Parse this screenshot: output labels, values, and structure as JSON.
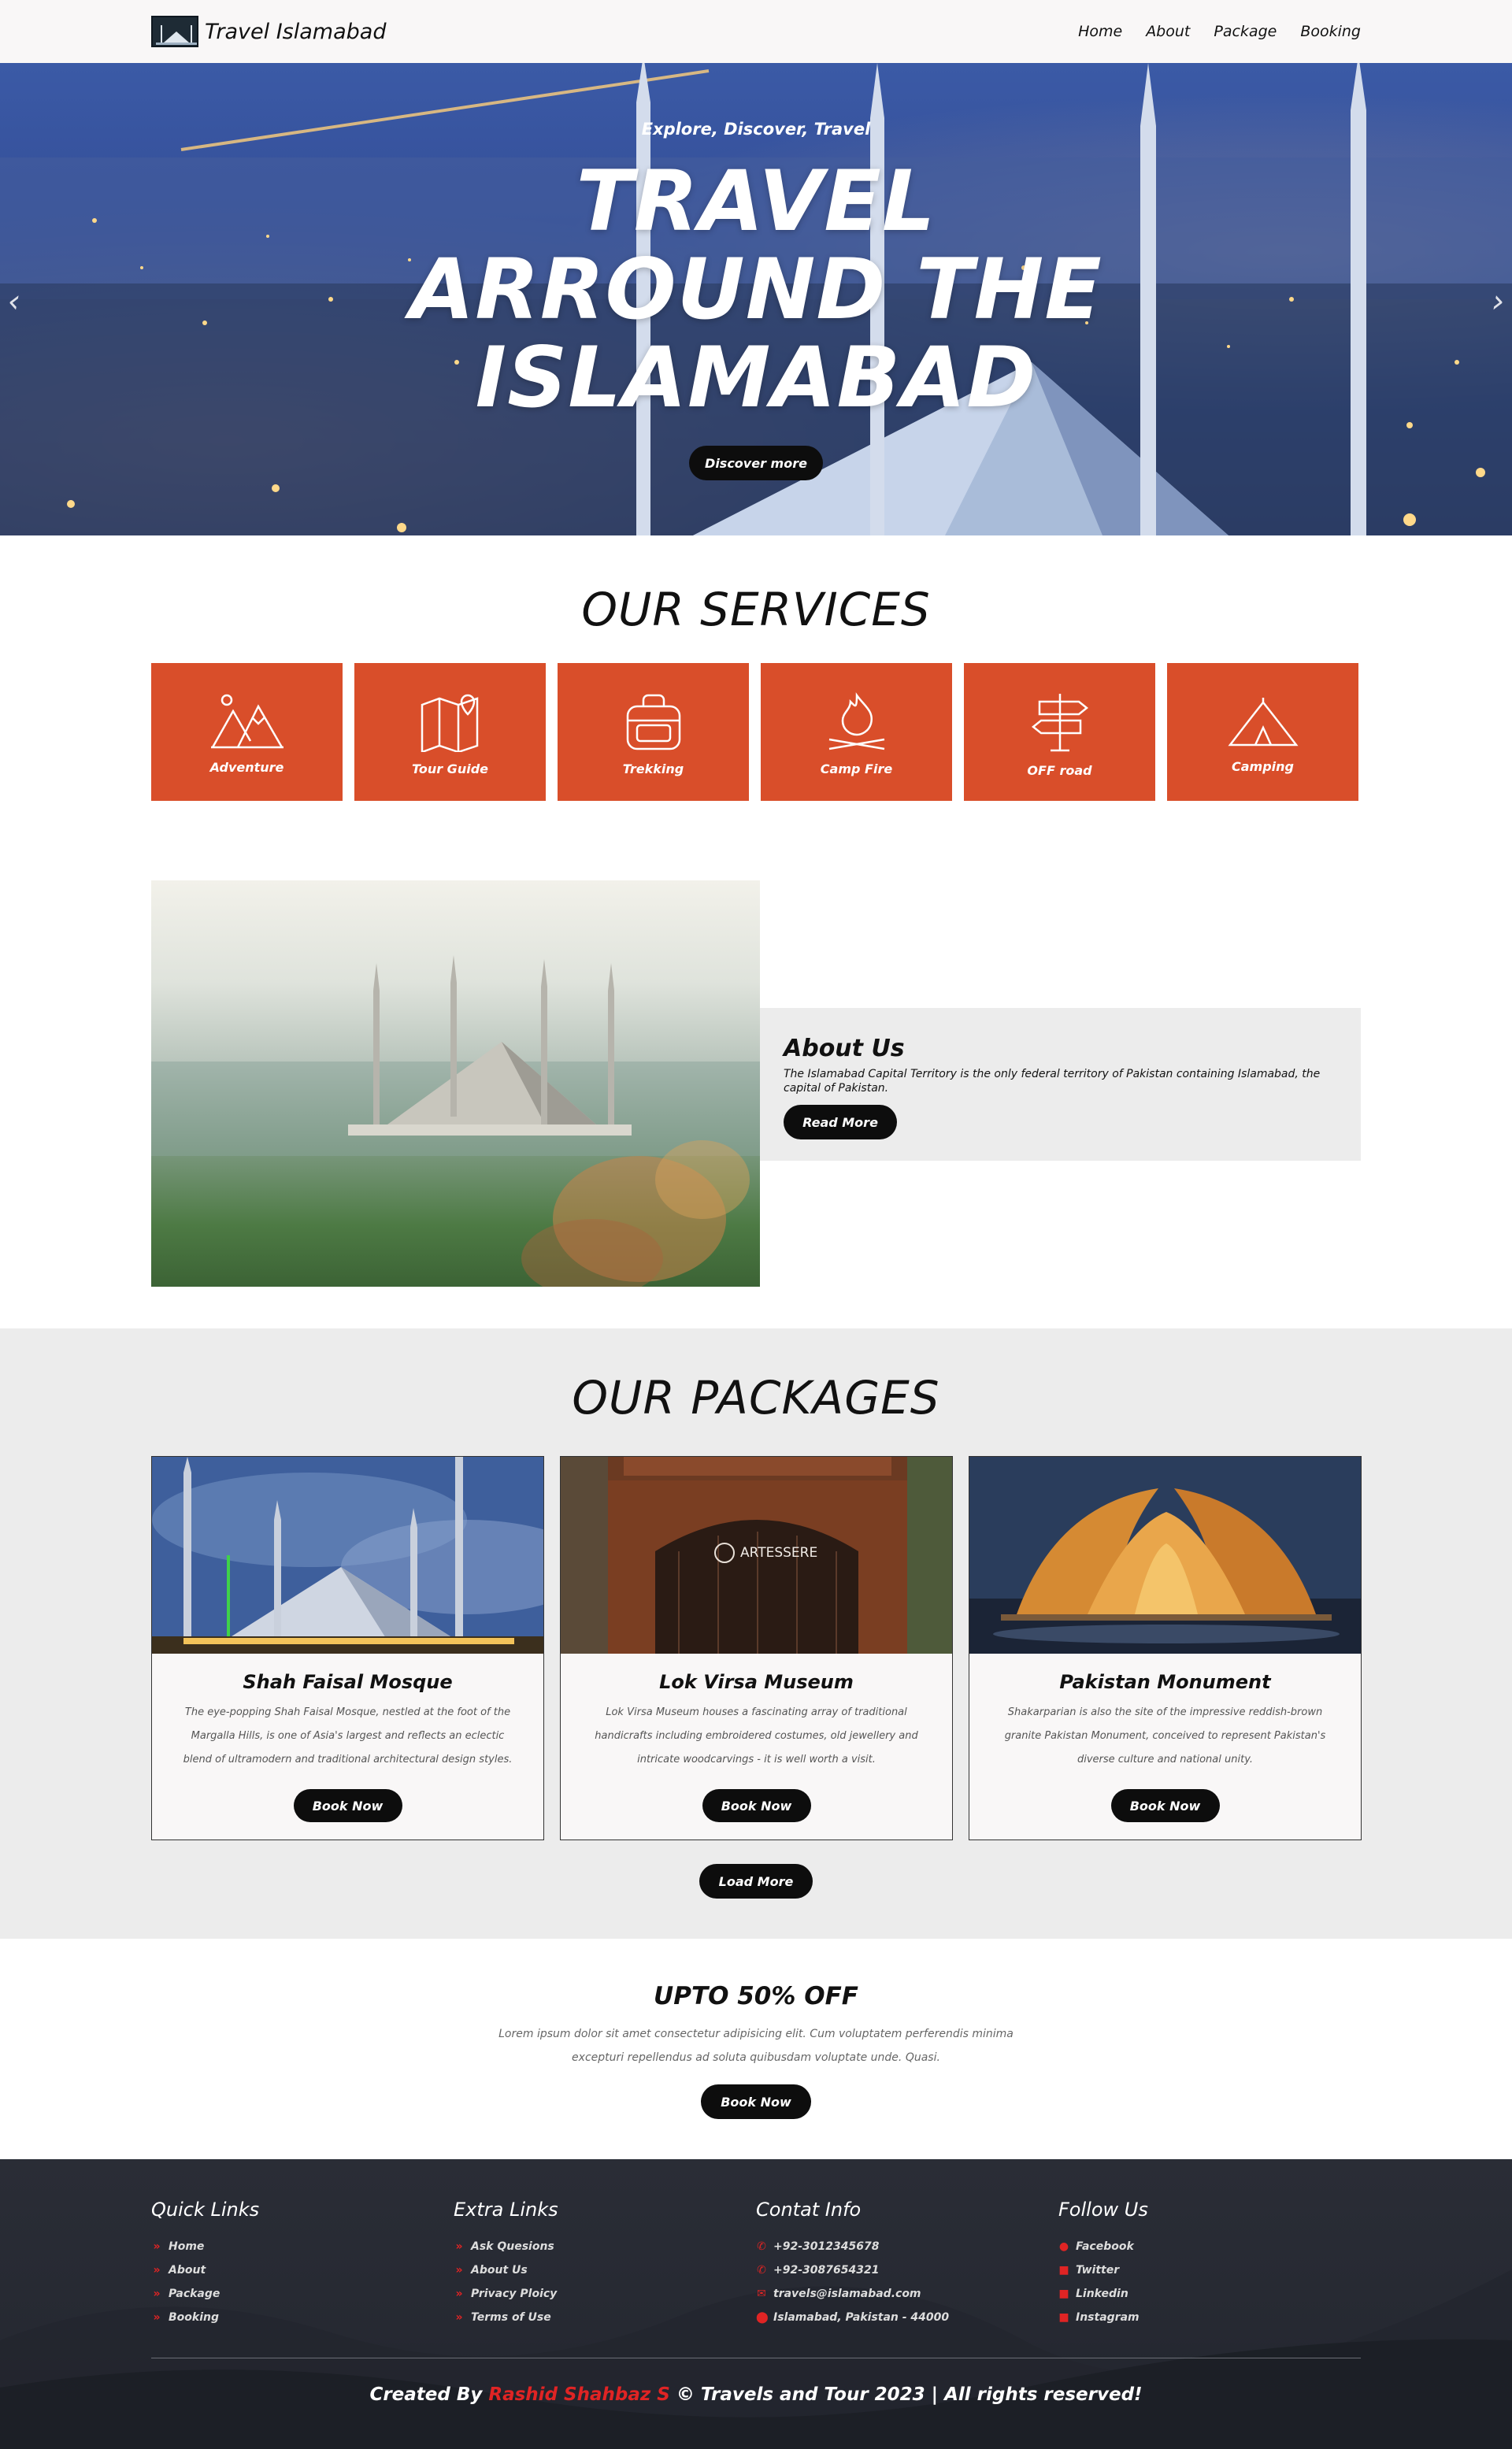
{
  "navbar": {
    "brand": "Travel Islamabad",
    "links": [
      "Home",
      "About",
      "Package",
      "Booking"
    ]
  },
  "hero": {
    "tagline": "Explore, Discover, Travel",
    "title_line1": "TRAVEL",
    "title_line2": "ARROUND THE",
    "title_line3": "ISLAMABAD",
    "button": "Discover more"
  },
  "services": {
    "title": "OUR SERVICES",
    "items": [
      {
        "label": "Adventure",
        "icon": "mountain-icon"
      },
      {
        "label": "Tour Guide",
        "icon": "map-icon"
      },
      {
        "label": "Trekking",
        "icon": "backpack-icon"
      },
      {
        "label": "Camp Fire",
        "icon": "campfire-icon"
      },
      {
        "label": "OFF road",
        "icon": "signpost-icon"
      },
      {
        "label": "Camping",
        "icon": "tent-icon"
      }
    ],
    "card_color": "#d94e2a"
  },
  "about": {
    "title": "About Us",
    "text": "The Islamabad Capital Territory is the only federal territory of Pakistan containing Islamabad, the capital of Pakistan.",
    "button": "Read More"
  },
  "packages": {
    "title": "OUR PACKAGES",
    "items": [
      {
        "name": "Shah Faisal Mosque",
        "desc_lines": [
          "The eye-popping Shah Faisal Mosque, nestled at the foot of the",
          "Margalla Hills, is one of Asia's largest and reflects an eclectic",
          "blend of ultramodern and traditional architectural design styles."
        ],
        "button": "Book Now"
      },
      {
        "name": "Lok Virsa Museum",
        "desc_lines": [
          "Lok Virsa Museum houses a fascinating array of traditional",
          "handicrafts including embroidered costumes, old jewellery and",
          "intricate woodcarvings - it is well worth a visit."
        ],
        "button": "Book Now",
        "sign_text": "ARTESSERE"
      },
      {
        "name": "Pakistan Monument",
        "desc_lines": [
          "Shakarparian is also the site of the impressive reddish-brown",
          "granite Pakistan Monument, conceived to represent Pakistan's",
          "diverse culture and national unity."
        ],
        "button": "Book Now"
      }
    ],
    "load_more": "Load More"
  },
  "offer": {
    "title": "UPTO 50% OFF",
    "text_line1": "Lorem ipsum dolor sit amet consectetur adipisicing elit. Cum voluptatem perferendis minima",
    "text_line2": "excepturi repellendus ad soluta quibusdam voluptate unde. Quasi.",
    "button": "Book Now"
  },
  "footer": {
    "quick_links": {
      "title": "Quick Links",
      "items": [
        "Home",
        "About",
        "Package",
        "Booking"
      ]
    },
    "extra_links": {
      "title": "Extra Links",
      "items": [
        "Ask Quesions",
        "About Us",
        "Privacy Ploicy",
        "Terms of Use"
      ]
    },
    "contact": {
      "title": "Contat Info",
      "items": [
        "+92-3012345678",
        "+92-3087654321",
        "travels@islamabad.com",
        "Islamabad, Pakistan - 44000"
      ]
    },
    "follow": {
      "title": "Follow Us",
      "items": [
        "Facebook",
        "Twitter",
        "Linkedin",
        "Instagram"
      ]
    },
    "credit_prefix": "Created By",
    "credit_author": "Rashid Shahbaz S",
    "credit_suffix": "© Travels and Tour 2023 | All rights reserved!"
  },
  "colors": {
    "accent": "#d94e2a",
    "link_icon": "#e02424",
    "button": "#0d0d0d"
  }
}
